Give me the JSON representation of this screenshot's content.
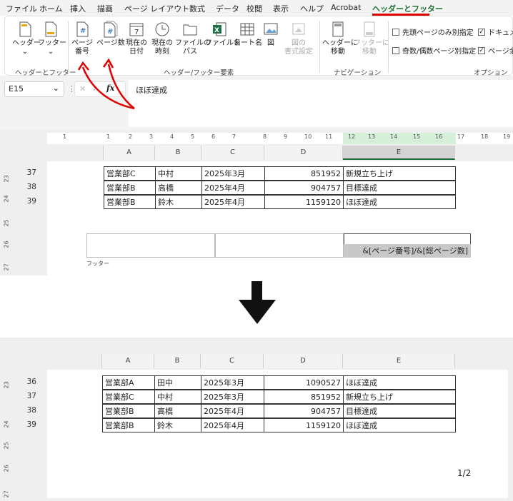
{
  "menu": {
    "items": [
      "ファイル",
      "ホーム",
      "挿入",
      "描画",
      "ページ レイアウト",
      "数式",
      "データ",
      "校閲",
      "表示",
      "ヘルプ",
      "Acrobat",
      "ヘッダーとフッター"
    ]
  },
  "ribbon": {
    "header_btn": "ヘッダー",
    "footer_btn": "フッター",
    "group1": "ヘッダーとフッター",
    "page_num_1": "ページ",
    "page_num_2": "番号",
    "page_count": "ページ数",
    "cur_date_1": "現在の",
    "cur_date_2": "日付",
    "cur_time_1": "現在の",
    "cur_time_2": "時刻",
    "file_path_1": "ファイルの",
    "file_path_2": "パス",
    "file_name": "ファイル名",
    "sheet_name": "シート名",
    "picture": "図",
    "fmt_pic_1": "図の",
    "fmt_pic_2": "書式設定",
    "group2": "ヘッダー/フッター要素",
    "goto_header_1": "ヘッダーに",
    "goto_header_2": "移動",
    "goto_footer_1": "フッターに",
    "goto_footer_2": "移動",
    "group3": "ナビゲーション",
    "opt1": "先頭ページのみ別指定",
    "opt2": "奇数/偶数ページ別指定",
    "opt3": "ドキュメン",
    "opt4": "ページ余白",
    "group4": "オプション",
    "opt3_checked": "✓",
    "opt4_checked": "✓"
  },
  "formula": {
    "cell_ref": "E15",
    "content": "ほぼ達成",
    "fx": "fx",
    "cancel": "✕",
    "confirm": "✓"
  },
  "columns": [
    "A",
    "B",
    "C",
    "D",
    "E"
  ],
  "ruler_ticks": [
    "1",
    "1",
    "2",
    "3",
    "4",
    "5",
    "6",
    "7",
    "8",
    "9",
    "10",
    "11",
    "12",
    "13",
    "14",
    "15",
    "16",
    "17",
    "18",
    "19"
  ],
  "top": {
    "rows": [
      {
        "num": "37",
        "name": "営業部C",
        "person": "中村",
        "date": "2025年3月",
        "amount": "851952",
        "status": "新規立ち上げ"
      },
      {
        "num": "38",
        "name": "営業部B",
        "person": "高橋",
        "date": "2025年4月",
        "amount": "904757",
        "status": "目標達成"
      },
      {
        "num": "39",
        "name": "営業部B",
        "person": "鈴木",
        "date": "2025年4月",
        "amount": "1159120",
        "status": "ほぼ達成"
      }
    ],
    "vruler": [
      "23",
      "24",
      "25",
      "26",
      "27"
    ],
    "footer_code": "&[ページ番号]/&[総ページ数]",
    "footer_label": "フッター"
  },
  "bottom": {
    "rows": [
      {
        "num": "36",
        "name": "営業部A",
        "person": "田中",
        "date": "2025年3月",
        "amount": "1090527",
        "status": "ほぼ達成"
      },
      {
        "num": "37",
        "name": "営業部C",
        "person": "中村",
        "date": "2025年3月",
        "amount": "851952",
        "status": "新規立ち上げ"
      },
      {
        "num": "38",
        "name": "営業部B",
        "person": "高橋",
        "date": "2025年4月",
        "amount": "904757",
        "status": "目標達成"
      },
      {
        "num": "39",
        "name": "営業部B",
        "person": "鈴木",
        "date": "2025年4月",
        "amount": "1159120",
        "status": "ほぼ達成"
      }
    ],
    "vruler": [
      "23",
      "24",
      "25",
      "26",
      "27"
    ],
    "page_result": "1/2"
  },
  "colors": {
    "accent": "#1c6e2f",
    "annotation": "#e00000"
  }
}
